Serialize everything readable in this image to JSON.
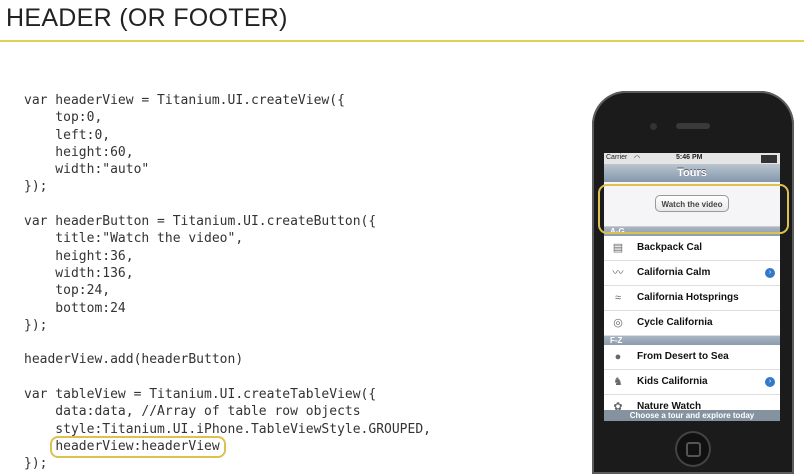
{
  "slide": {
    "title": "HEADER (OR FOOTER)",
    "accent_color": "#dcd256",
    "highlight_color": "#dcc050"
  },
  "code": {
    "lines": [
      "var headerView = Titanium.UI.createView({",
      "    top:0,",
      "    left:0,",
      "    height:60,",
      "    width:\"auto\"",
      "});",
      "",
      "var headerButton = Titanium.UI.createButton({",
      "    title:\"Watch the video\",",
      "    height:36,",
      "    width:136,",
      "    top:24,",
      "    bottom:24",
      "});",
      "",
      "headerView.add(headerButton)",
      "",
      "var tableView = Titanium.UI.createTableView({",
      "    data:data, //Array of table row objects",
      "    style:Titanium.UI.iPhone.TableViewStyle.GROUPED,",
      "    ",
      "});"
    ],
    "highlight_prefix": "    ",
    "highlight_text": "headerView:headerView"
  },
  "phone": {
    "status": {
      "carrier": "Carrier",
      "time": "5:46 PM"
    },
    "nav_title": "Tours",
    "header_button": "Watch the video",
    "sections": [
      {
        "title": "A-G",
        "rows": [
          {
            "label": "Backpack Cal",
            "thumb_icon": "backpack-logo-icon",
            "thumb_glyph": "▤",
            "disclosure": false
          },
          {
            "label": "California Calm",
            "thumb_icon": "wave-logo-icon",
            "thumb_glyph": "〰",
            "disclosure": true
          },
          {
            "label": "California Hotsprings",
            "thumb_icon": "hotsprings-logo-icon",
            "thumb_glyph": "≈",
            "disclosure": false
          },
          {
            "label": "Cycle California",
            "thumb_icon": "cycle-logo-icon",
            "thumb_glyph": "◎",
            "disclosure": false
          }
        ]
      },
      {
        "title": "F-Z",
        "rows": [
          {
            "label": "From Desert to Sea",
            "thumb_icon": "desert-logo-icon",
            "thumb_glyph": "●",
            "disclosure": false
          },
          {
            "label": "Kids California",
            "thumb_icon": "kids-logo-icon",
            "thumb_glyph": "♞",
            "disclosure": true
          },
          {
            "label": "Nature Watch",
            "thumb_icon": "nature-logo-icon",
            "thumb_glyph": "✿",
            "disclosure": false
          }
        ]
      }
    ],
    "footer": "Choose a tour and explore today",
    "disclosure_glyph": "›"
  }
}
